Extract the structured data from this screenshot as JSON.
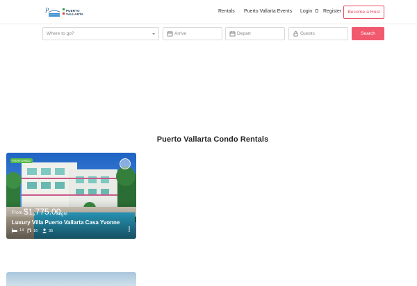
{
  "header": {
    "logo_text_line1": "PUERTO",
    "logo_text_line2": "VALLARTA",
    "nav": {
      "rentals": "Rentals",
      "events": "Puerto Vallarta Events",
      "login": "Login",
      "separator": "O",
      "register": "Register"
    },
    "host_button": "Become a Host"
  },
  "search": {
    "where_placeholder": "Where to go?",
    "arrive_placeholder": "Arrive",
    "depart_placeholder": "Depart",
    "guests_placeholder": "Guests",
    "button": "Search"
  },
  "section_title": "Puerto Vallarta Condo Rentals",
  "listings": [
    {
      "badge": "FEATURED",
      "price_prefix": "From",
      "price": "$1,775.00",
      "price_suffix": "/night",
      "title": "Luxury Villa Puerto Vallarta Casa Yvonne",
      "bedrooms": "14",
      "bathrooms": "16",
      "guests": "35"
    }
  ],
  "colors": {
    "accent": "#f15a6e",
    "badge": "#57b94a"
  }
}
